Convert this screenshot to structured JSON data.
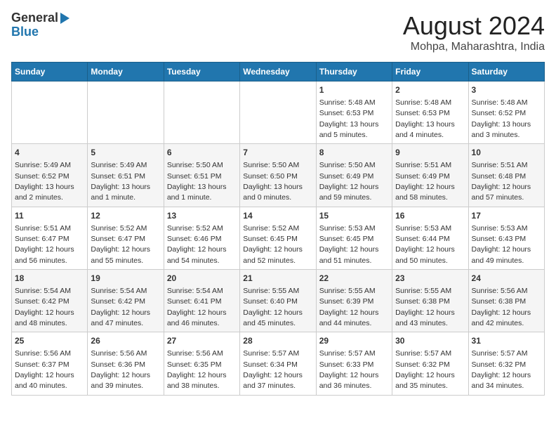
{
  "header": {
    "logo_line1": "General",
    "logo_line2": "Blue",
    "title": "August 2024",
    "subtitle": "Mohpa, Maharashtra, India"
  },
  "weekdays": [
    "Sunday",
    "Monday",
    "Tuesday",
    "Wednesday",
    "Thursday",
    "Friday",
    "Saturday"
  ],
  "weeks": [
    [
      {
        "day": "",
        "info": ""
      },
      {
        "day": "",
        "info": ""
      },
      {
        "day": "",
        "info": ""
      },
      {
        "day": "",
        "info": ""
      },
      {
        "day": "1",
        "info": "Sunrise: 5:48 AM\nSunset: 6:53 PM\nDaylight: 13 hours\nand 5 minutes."
      },
      {
        "day": "2",
        "info": "Sunrise: 5:48 AM\nSunset: 6:53 PM\nDaylight: 13 hours\nand 4 minutes."
      },
      {
        "day": "3",
        "info": "Sunrise: 5:48 AM\nSunset: 6:52 PM\nDaylight: 13 hours\nand 3 minutes."
      }
    ],
    [
      {
        "day": "4",
        "info": "Sunrise: 5:49 AM\nSunset: 6:52 PM\nDaylight: 13 hours\nand 2 minutes."
      },
      {
        "day": "5",
        "info": "Sunrise: 5:49 AM\nSunset: 6:51 PM\nDaylight: 13 hours\nand 1 minute."
      },
      {
        "day": "6",
        "info": "Sunrise: 5:50 AM\nSunset: 6:51 PM\nDaylight: 13 hours\nand 1 minute."
      },
      {
        "day": "7",
        "info": "Sunrise: 5:50 AM\nSunset: 6:50 PM\nDaylight: 13 hours\nand 0 minutes."
      },
      {
        "day": "8",
        "info": "Sunrise: 5:50 AM\nSunset: 6:49 PM\nDaylight: 12 hours\nand 59 minutes."
      },
      {
        "day": "9",
        "info": "Sunrise: 5:51 AM\nSunset: 6:49 PM\nDaylight: 12 hours\nand 58 minutes."
      },
      {
        "day": "10",
        "info": "Sunrise: 5:51 AM\nSunset: 6:48 PM\nDaylight: 12 hours\nand 57 minutes."
      }
    ],
    [
      {
        "day": "11",
        "info": "Sunrise: 5:51 AM\nSunset: 6:47 PM\nDaylight: 12 hours\nand 56 minutes."
      },
      {
        "day": "12",
        "info": "Sunrise: 5:52 AM\nSunset: 6:47 PM\nDaylight: 12 hours\nand 55 minutes."
      },
      {
        "day": "13",
        "info": "Sunrise: 5:52 AM\nSunset: 6:46 PM\nDaylight: 12 hours\nand 54 minutes."
      },
      {
        "day": "14",
        "info": "Sunrise: 5:52 AM\nSunset: 6:45 PM\nDaylight: 12 hours\nand 52 minutes."
      },
      {
        "day": "15",
        "info": "Sunrise: 5:53 AM\nSunset: 6:45 PM\nDaylight: 12 hours\nand 51 minutes."
      },
      {
        "day": "16",
        "info": "Sunrise: 5:53 AM\nSunset: 6:44 PM\nDaylight: 12 hours\nand 50 minutes."
      },
      {
        "day": "17",
        "info": "Sunrise: 5:53 AM\nSunset: 6:43 PM\nDaylight: 12 hours\nand 49 minutes."
      }
    ],
    [
      {
        "day": "18",
        "info": "Sunrise: 5:54 AM\nSunset: 6:42 PM\nDaylight: 12 hours\nand 48 minutes."
      },
      {
        "day": "19",
        "info": "Sunrise: 5:54 AM\nSunset: 6:42 PM\nDaylight: 12 hours\nand 47 minutes."
      },
      {
        "day": "20",
        "info": "Sunrise: 5:54 AM\nSunset: 6:41 PM\nDaylight: 12 hours\nand 46 minutes."
      },
      {
        "day": "21",
        "info": "Sunrise: 5:55 AM\nSunset: 6:40 PM\nDaylight: 12 hours\nand 45 minutes."
      },
      {
        "day": "22",
        "info": "Sunrise: 5:55 AM\nSunset: 6:39 PM\nDaylight: 12 hours\nand 44 minutes."
      },
      {
        "day": "23",
        "info": "Sunrise: 5:55 AM\nSunset: 6:38 PM\nDaylight: 12 hours\nand 43 minutes."
      },
      {
        "day": "24",
        "info": "Sunrise: 5:56 AM\nSunset: 6:38 PM\nDaylight: 12 hours\nand 42 minutes."
      }
    ],
    [
      {
        "day": "25",
        "info": "Sunrise: 5:56 AM\nSunset: 6:37 PM\nDaylight: 12 hours\nand 40 minutes."
      },
      {
        "day": "26",
        "info": "Sunrise: 5:56 AM\nSunset: 6:36 PM\nDaylight: 12 hours\nand 39 minutes."
      },
      {
        "day": "27",
        "info": "Sunrise: 5:56 AM\nSunset: 6:35 PM\nDaylight: 12 hours\nand 38 minutes."
      },
      {
        "day": "28",
        "info": "Sunrise: 5:57 AM\nSunset: 6:34 PM\nDaylight: 12 hours\nand 37 minutes."
      },
      {
        "day": "29",
        "info": "Sunrise: 5:57 AM\nSunset: 6:33 PM\nDaylight: 12 hours\nand 36 minutes."
      },
      {
        "day": "30",
        "info": "Sunrise: 5:57 AM\nSunset: 6:32 PM\nDaylight: 12 hours\nand 35 minutes."
      },
      {
        "day": "31",
        "info": "Sunrise: 5:57 AM\nSunset: 6:32 PM\nDaylight: 12 hours\nand 34 minutes."
      }
    ]
  ]
}
